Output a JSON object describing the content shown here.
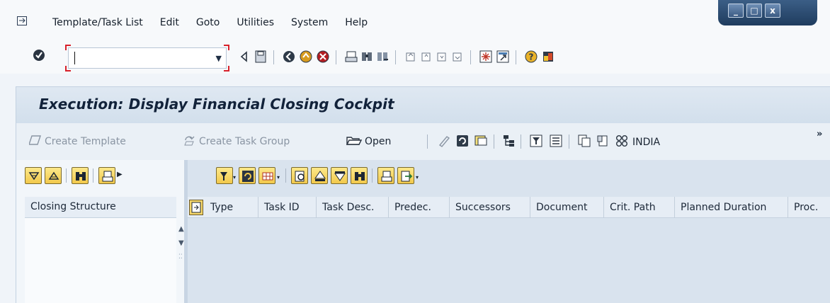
{
  "menu": {
    "items": [
      {
        "label": "Template/Task List"
      },
      {
        "label": "Edit"
      },
      {
        "label": "Goto"
      },
      {
        "label": "Utilities"
      },
      {
        "label": "System"
      },
      {
        "label": "Help"
      }
    ]
  },
  "window_controls": {
    "minimize": "_",
    "maximize": "□",
    "close": "x"
  },
  "command_field": {
    "value": ""
  },
  "title": "Execution: Display Financial Closing Cockpit",
  "app_toolbar": {
    "create_template": "Create Template",
    "create_task_group": "Create Task Group",
    "open": "Open",
    "india": "INDIA",
    "more": "»"
  },
  "left_pane": {
    "header": "Closing Structure"
  },
  "grid": {
    "columns": [
      {
        "label": "Type"
      },
      {
        "label": "Task ID"
      },
      {
        "label": "Task Desc."
      },
      {
        "label": "Predec."
      },
      {
        "label": "Successors"
      },
      {
        "label": "Document"
      },
      {
        "label": "Crit. Path"
      },
      {
        "label": "Planned Duration"
      },
      {
        "label": "Proc."
      }
    ]
  },
  "colors": {
    "title_bg": "#d8e3ef",
    "command_bracket": "#d8202a",
    "yellow_button": "#f2c94c"
  }
}
